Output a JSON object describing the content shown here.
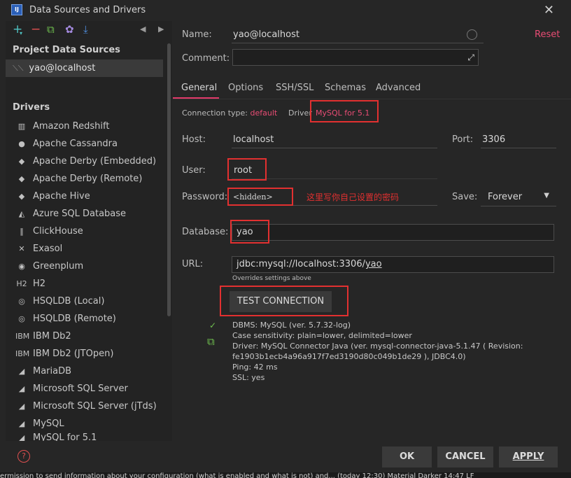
{
  "window": {
    "title": "Data Sources and Drivers",
    "app_icon_text": "IJ"
  },
  "toolbar": {
    "add": "+",
    "add_arrow": "▾",
    "remove": "−",
    "copy": "⧉",
    "settings": "✿",
    "import": "⤓",
    "back": "◀",
    "forward": "▶"
  },
  "project": {
    "section_title": "Project Data Sources",
    "item": "yao@localhost"
  },
  "drivers": {
    "section_title": "Drivers",
    "items": [
      {
        "label": "Amazon Redshift",
        "icon": "▥"
      },
      {
        "label": "Apache Cassandra",
        "icon": "●"
      },
      {
        "label": "Apache Derby (Embedded)",
        "icon": "◆"
      },
      {
        "label": "Apache Derby (Remote)",
        "icon": "◆"
      },
      {
        "label": "Apache Hive",
        "icon": "◆"
      },
      {
        "label": "Azure SQL Database",
        "icon": "◭"
      },
      {
        "label": "ClickHouse",
        "icon": "‖"
      },
      {
        "label": "Exasol",
        "icon": "✕"
      },
      {
        "label": "Greenplum",
        "icon": "◉"
      },
      {
        "label": "H2",
        "icon": "H2"
      },
      {
        "label": "HSQLDB (Local)",
        "icon": "◎"
      },
      {
        "label": "HSQLDB (Remote)",
        "icon": "◎"
      },
      {
        "label": "IBM Db2",
        "icon": "IBM"
      },
      {
        "label": "IBM Db2 (JTOpen)",
        "icon": "IBM"
      },
      {
        "label": "MariaDB",
        "icon": "◢"
      },
      {
        "label": "Microsoft SQL Server",
        "icon": "◢"
      },
      {
        "label": "Microsoft SQL Server (jTds)",
        "icon": "◢"
      },
      {
        "label": "MySQL",
        "icon": "◢"
      },
      {
        "label": "MySQL for 5.1",
        "icon": "◢"
      }
    ]
  },
  "form": {
    "name_label": "Name:",
    "name_value": "yao@localhost",
    "reset": "Reset",
    "comment_label": "Comment:",
    "tabs": [
      "General",
      "Options",
      "SSH/SSL",
      "Schemas",
      "Advanced"
    ],
    "connection_type_label": "Connection type:",
    "connection_type_value": "default",
    "driver_label": "Driver",
    "driver_value": "MySQL for 5.1",
    "host_label": "Host:",
    "host_value": "localhost",
    "port_label": "Port:",
    "port_value": "3306",
    "user_label": "User:",
    "user_value": "root",
    "password_label": "Password:",
    "password_value": "<hidden>",
    "annotation": "这里写你自己设置的密码",
    "save_label": "Save:",
    "save_value": "Forever",
    "database_label": "Database:",
    "database_value": "yao",
    "url_label": "URL:",
    "url_value_prefix": "jdbc:mysql://localhost:3306/",
    "url_value_db": "yao",
    "url_hint": "Overrides settings above",
    "test_button": "TEST CONNECTION"
  },
  "test_result": {
    "lines": [
      "DBMS: MySQL (ver. 5.7.32-log)",
      "Case sensitivity: plain=lower, delimited=lower",
      "Driver: MySQL Connector Java (ver. mysql-connector-java-5.1.47 ( Revision:",
      "fe1903b1ecb4a96a917f7ed3190d80c049b1de29 ), JDBC4.0)",
      "Ping: 42 ms",
      "SSL: yes"
    ]
  },
  "buttons": {
    "ok": "OK",
    "cancel": "CANCEL",
    "apply": "APPLY"
  },
  "statusbar": {
    "text": "ermission to send information about your configuration (what is enabled and what is not) and... (today 12:30)   Material Darker   14:47   LF"
  },
  "colors": {
    "accent": "#e84c74",
    "highlight": "#e23030",
    "bg": "#262626"
  }
}
